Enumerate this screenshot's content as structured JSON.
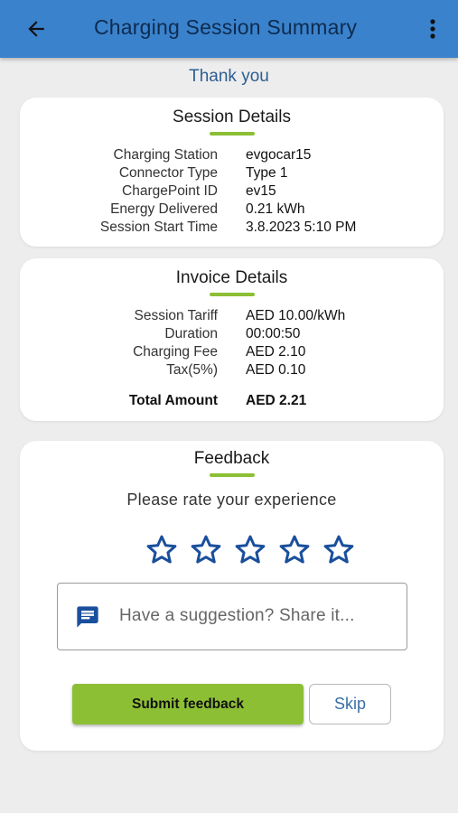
{
  "header": {
    "title": "Charging Session Summary",
    "back_icon": "arrow-back-icon",
    "menu_icon": "more-vert-icon",
    "color": "#3a82cc"
  },
  "thank_you": "Thank you",
  "session_details": {
    "title": "Session Details",
    "rows": [
      {
        "label": "Charging Station",
        "value": "evgocar15"
      },
      {
        "label": "Connector Type",
        "value": "Type 1"
      },
      {
        "label": "ChargePoint ID",
        "value": "ev15"
      },
      {
        "label": "Energy Delivered",
        "value": "0.21 kWh"
      },
      {
        "label": "Session Start Time",
        "value": "3.8.2023 5:10 PM"
      }
    ]
  },
  "invoice_details": {
    "title": "Invoice Details",
    "rows": [
      {
        "label": "Session Tariff",
        "value": "AED 10.00/kWh"
      },
      {
        "label": "Duration",
        "value": "00:00:50"
      },
      {
        "label": "Charging Fee",
        "value": "AED 2.10"
      },
      {
        "label": "Tax(5%)",
        "value": "AED 0.10"
      }
    ],
    "total": {
      "label": "Total Amount",
      "value": "AED 2.21"
    }
  },
  "feedback": {
    "title": "Feedback",
    "prompt": "Please rate your experience",
    "rating": {
      "value": 0,
      "max": 5
    },
    "suggestion_placeholder": "Have a suggestion? Share it...",
    "submit_label": "Submit feedback",
    "skip_label": "Skip"
  },
  "colors": {
    "accent_green": "#8dbf35",
    "star_blue": "#1a4f9c",
    "link_blue": "#3a6ea8"
  }
}
